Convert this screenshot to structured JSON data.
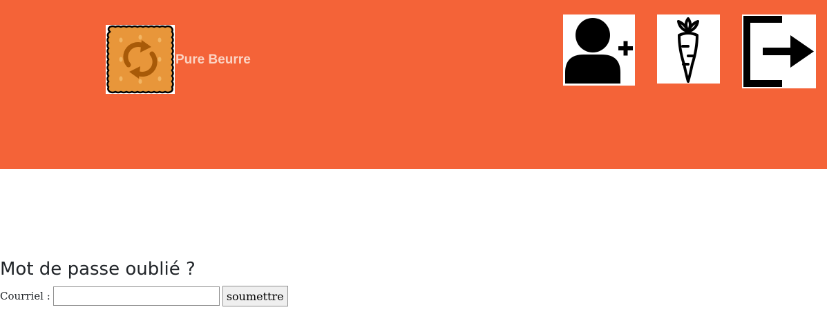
{
  "header": {
    "brand_name": "Pure Beurre",
    "logo_icon": "biscuit-refresh-icon",
    "background_color": "#f46338",
    "nav": [
      {
        "icon": "user-add-icon",
        "purpose": "signup"
      },
      {
        "icon": "carrot-icon",
        "purpose": "foods"
      },
      {
        "icon": "logout-icon",
        "purpose": "logout"
      }
    ]
  },
  "main": {
    "title": "Mot de passe oublié ?",
    "form": {
      "email_label": "Courriel :",
      "email_value": "",
      "email_placeholder": "",
      "submit_label": "soumettre"
    }
  }
}
